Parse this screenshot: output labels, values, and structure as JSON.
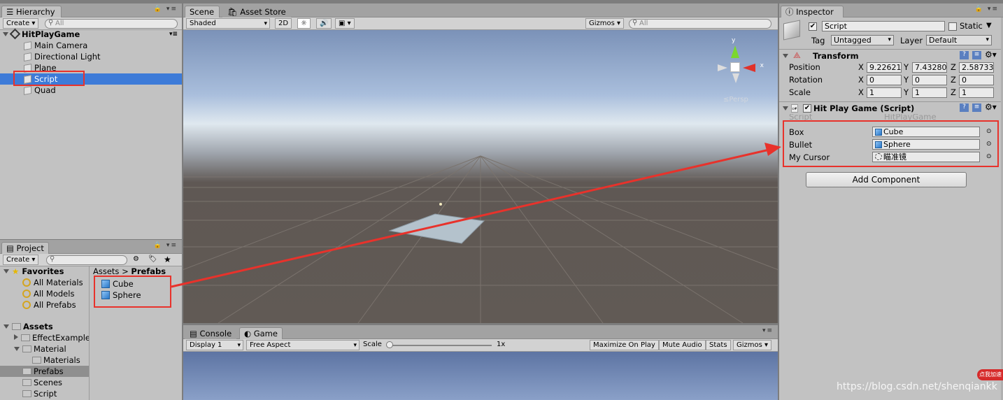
{
  "hierarchy": {
    "tab": "Hierarchy",
    "create": "Create ▾",
    "search_placeholder": "All",
    "scene_name": "HitPlayGame",
    "items": [
      "Main Camera",
      "Directional Light",
      "Plane",
      "Script",
      "Quad"
    ]
  },
  "project": {
    "tab": "Project",
    "create": "Create ▾",
    "favorites_label": "Favorites",
    "favorites": [
      "All Materials",
      "All Models",
      "All Prefabs"
    ],
    "assets_label": "Assets",
    "assets_tree": [
      "EffectExample",
      "Material",
      "Materials",
      "Prefabs",
      "Scenes",
      "Script"
    ],
    "breadcrumb_root": "Assets",
    "breadcrumb_sep": ">",
    "breadcrumb_current": "Prefabs",
    "prefabs": [
      "Cube",
      "Sphere"
    ]
  },
  "scene": {
    "tabs": [
      "Scene",
      "Asset Store"
    ],
    "shading": "Shaded",
    "mode_2d": "2D",
    "gizmos": "Gizmos ▾",
    "search_placeholder": "All",
    "gizmo_y": "y",
    "gizmo_x": "x",
    "persp": "≤Persp"
  },
  "game": {
    "tabs": [
      "Console",
      "Game"
    ],
    "display": "Display 1",
    "aspect": "Free Aspect",
    "scale_label": "Scale",
    "scale_value": "1x",
    "maximize": "Maximize On Play",
    "mute": "Mute Audio",
    "stats": "Stats",
    "gizmos": "Gizmos ▾"
  },
  "inspector": {
    "tab": "Inspector",
    "object_name": "Script",
    "static_label": "Static",
    "tag_label": "Tag",
    "tag_value": "Untagged",
    "layer_label": "Layer",
    "layer_value": "Default",
    "transform": {
      "title": "Transform",
      "position_label": "Position",
      "rotation_label": "Rotation",
      "scale_label": "Scale",
      "position": [
        "9.22621",
        "7.43280",
        "2.58733"
      ],
      "rotation": [
        "0",
        "0",
        "0"
      ],
      "scale": [
        "1",
        "1",
        "1"
      ],
      "axes": [
        "X",
        "Y",
        "Z"
      ]
    },
    "component": {
      "title": "Hit Play Game (Script)",
      "script_label": "Script",
      "script_value": "HitPlayGame",
      "fields": [
        {
          "label": "Box",
          "value": "Cube"
        },
        {
          "label": "Bullet",
          "value": "Sphere"
        },
        {
          "label": "My Cursor",
          "value": "瞄准镜"
        }
      ]
    },
    "add_component": "Add Component"
  },
  "watermark": "https://blog.csdn.net/shenqiankk",
  "badge": "点我加速",
  "colors": {
    "selection": "#3d7bd8",
    "annotation": "#e8322b",
    "panel": "#c2c2c2"
  }
}
